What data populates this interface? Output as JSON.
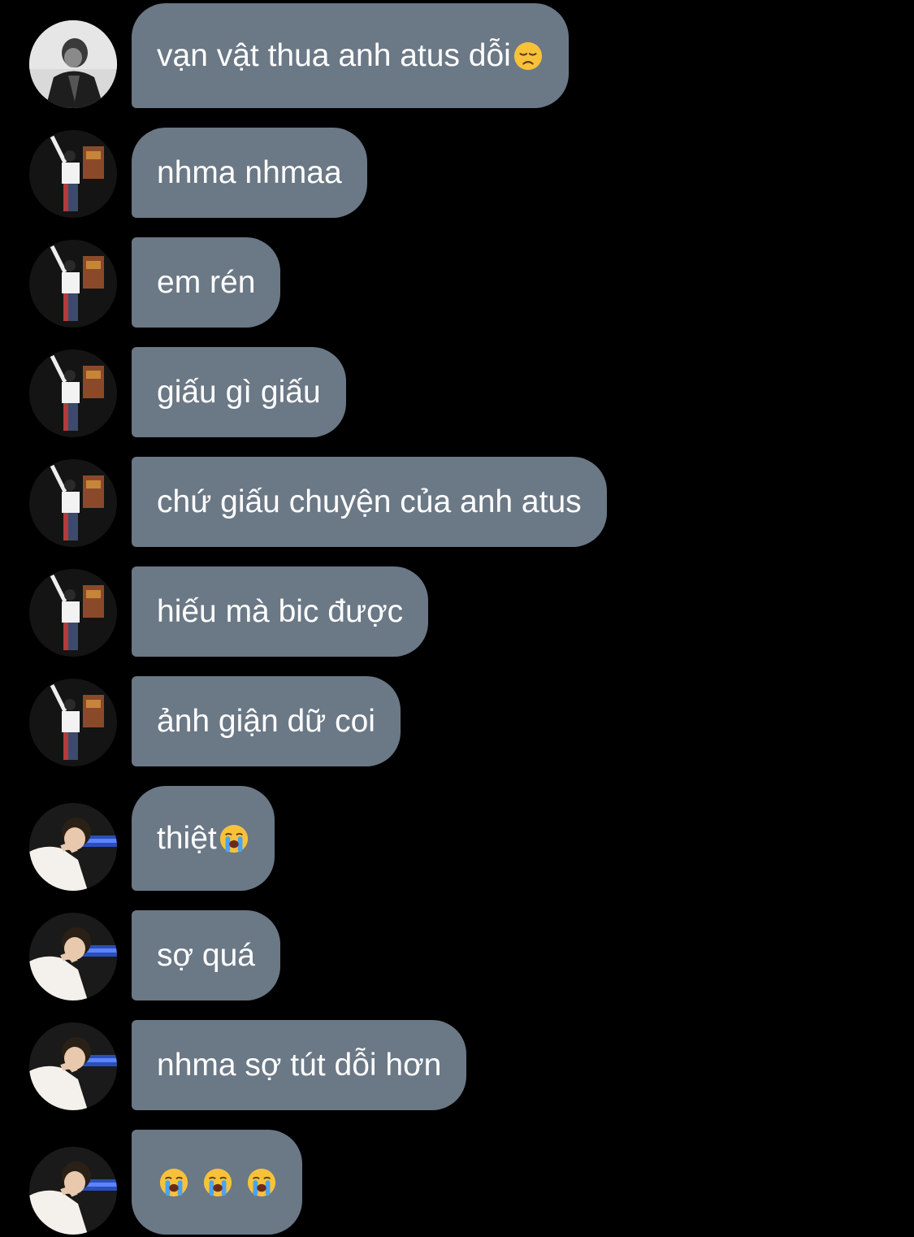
{
  "messages": [
    {
      "text": "vạn vật thua anh atus dỗi",
      "emoji": "disappointed-face",
      "avatar": "avatar-bw"
    },
    {
      "text": "nhma nhmaa",
      "emoji": "",
      "avatar": "avatar-poster"
    },
    {
      "text": "em rén",
      "emoji": "",
      "avatar": "avatar-poster"
    },
    {
      "text": "giấu gì giấu",
      "emoji": "",
      "avatar": "avatar-poster"
    },
    {
      "text": "chứ giấu chuyện của anh atus",
      "emoji": "",
      "avatar": "avatar-poster"
    },
    {
      "text": "hiếu mà bic được",
      "emoji": "",
      "avatar": "avatar-poster"
    },
    {
      "text": "ảnh giận dữ coi",
      "emoji": "",
      "avatar": "avatar-poster"
    },
    {
      "text": "thiệt ",
      "emoji": "loudly-crying-face",
      "avatar": "avatar-white-shirt"
    },
    {
      "text": "sợ quá",
      "emoji": "",
      "avatar": "avatar-white-shirt"
    },
    {
      "text": "nhma sợ tút dỗi hơn",
      "emoji": "",
      "avatar": "avatar-white-shirt"
    },
    {
      "text": "",
      "emoji": "loudly-crying-face x3",
      "avatar": "avatar-white-shirt"
    }
  ],
  "colors": {
    "background": "#000000",
    "bubble": "#6b7886",
    "text": "#ffffff"
  }
}
